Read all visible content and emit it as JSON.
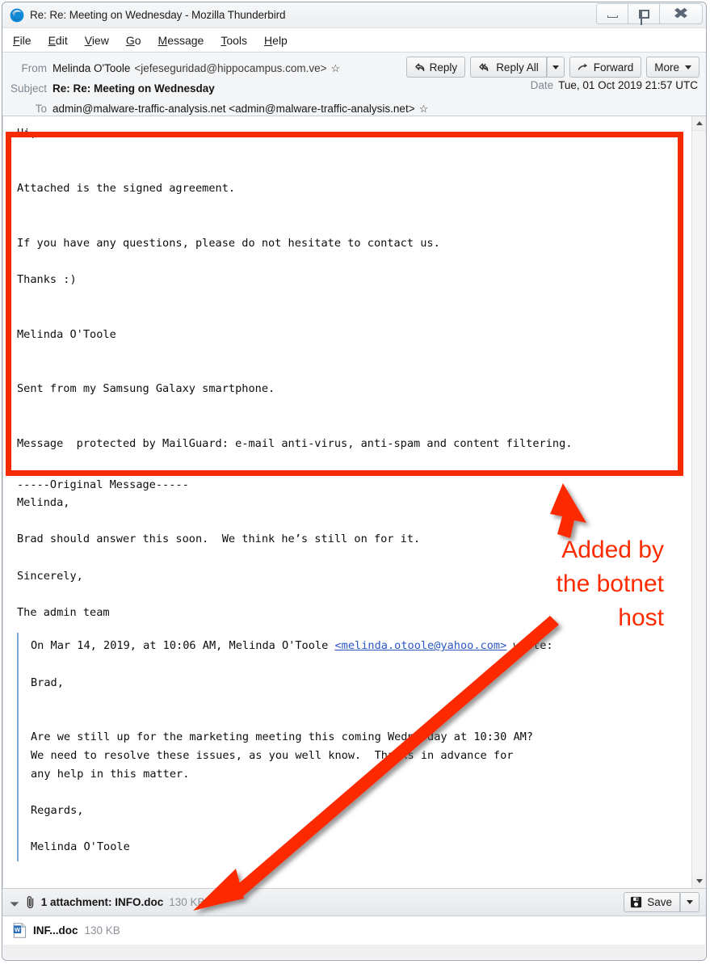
{
  "window": {
    "title": "Re: Re: Meeting on Wednesday - Mozilla Thunderbird",
    "logo_icon": "thunderbird-logo-icon",
    "minimize_icon": "minimize-icon",
    "maximize_icon": "maximize-icon",
    "close_icon": "close-icon"
  },
  "menubar": {
    "items": [
      {
        "label": "File",
        "accel": "F"
      },
      {
        "label": "Edit",
        "accel": "E"
      },
      {
        "label": "View",
        "accel": "V"
      },
      {
        "label": "Go",
        "accel": "G"
      },
      {
        "label": "Message",
        "accel": "M"
      },
      {
        "label": "Tools",
        "accel": "T"
      },
      {
        "label": "Help",
        "accel": "H"
      }
    ]
  },
  "header": {
    "from_label": "From",
    "from_name": "Melinda O'Toole",
    "from_address": "<jefeseguridad@hippocampus.com.ve>",
    "subject_label": "Subject",
    "subject_value": "Re: Re: Meeting on Wednesday",
    "date_label": "Date",
    "date_value": "Tue, 01 Oct 2019 21:57 UTC",
    "to_label": "To",
    "to_value": "admin@malware-traffic-analysis.net <admin@malware-traffic-analysis.net>",
    "star_icon": "star-icon"
  },
  "toolbar": {
    "reply_label": "Reply",
    "reply_all_label": "Reply All",
    "forward_label": "Forward",
    "more_label": "More",
    "reply_icon": "reply-arrow-icon",
    "reply_all_icon": "reply-all-arrow-icon",
    "forward_icon": "forward-arrow-icon",
    "dropdown_icon": "chevron-down-icon"
  },
  "body": {
    "new_message_lines": [
      "Hi,",
      "",
      "",
      "Attached is the signed agreement.",
      "",
      "",
      "If you have any questions, please do not hesitate to contact us.",
      "",
      "Thanks :)",
      "",
      "",
      "Melinda O'Toole",
      "",
      "",
      "Sent from my Samsung Galaxy smartphone.",
      "",
      "",
      "Message  protected by MailGuard: e-mail anti-virus, anti-spam and content filtering."
    ],
    "original_message_lines": [
      "-----Original Message-----",
      "Melinda,",
      "",
      "Brad should answer this soon.  We think he’s still on for it.",
      "",
      "Sincerely,",
      "",
      "The admin team"
    ],
    "quote": {
      "intro_prefix": "On Mar 14, 2019, at 10:06 AM, Melinda O'Toole ",
      "intro_link": "<melinda.otoole@yahoo.com>",
      "intro_suffix": " wrote:",
      "lines": [
        "",
        "Brad,",
        "",
        "",
        "Are we still up for the marketing meeting this coming Wednesday at 10:30 AM?",
        "We need to resolve these issues, as you well know.  Thanks in advance for",
        "any help in this matter.",
        "",
        "Regards,",
        "",
        "Melinda O'Toole"
      ]
    }
  },
  "attachment_bar": {
    "toggle_icon": "expand-triangle-icon",
    "clip_icon": "paperclip-icon",
    "summary": "1 attachment: INFO.doc",
    "summary_size": "130 KB",
    "save_label": "Save",
    "save_icon": "save-disk-icon",
    "save_caret_icon": "chevron-down-icon"
  },
  "attachment_list": {
    "file_icon": "word-document-icon",
    "file_name": "INF...doc",
    "file_size": "130 KB"
  },
  "scrollbar": {
    "up_icon": "scroll-up-triangle-icon",
    "down_icon": "scroll-down-triangle-icon"
  },
  "annotations": {
    "callout_lines": [
      "Added by",
      "the botnet",
      "host"
    ],
    "callout_color": "#fd2b00",
    "box_color": "#f42b00",
    "arrow_up_icon": "annotation-arrow-up-icon",
    "arrow_down_left_icon": "annotation-arrow-down-left-icon",
    "highlight_box_icon": "annotation-highlight-box"
  }
}
